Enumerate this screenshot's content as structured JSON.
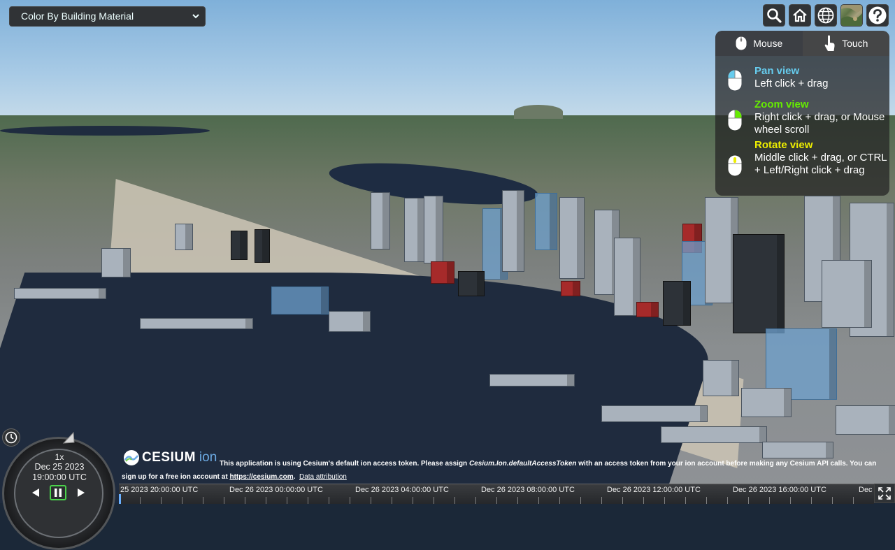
{
  "material_select": {
    "value": "Color By Building Material"
  },
  "toolbar": {
    "geocoder": "search-icon",
    "home": "home-icon",
    "scene_mode": "globe-icon",
    "base_layer": "imagery-thumbnail-icon",
    "help": "question-icon"
  },
  "navigation_help": {
    "tabs": [
      {
        "label": "Mouse",
        "active": true
      },
      {
        "label": "Touch",
        "active": false
      }
    ],
    "instructions": [
      {
        "title": "Pan view",
        "desc": "Left click + drag",
        "color": "#66ccee"
      },
      {
        "title": "Zoom view",
        "desc": "Right click + drag, or Mouse wheel scroll",
        "color": "#65ec00"
      },
      {
        "title": "Rotate view",
        "desc": "Middle click + drag, or CTRL + Left/Right click + drag",
        "color": "#eeee00"
      }
    ]
  },
  "animation": {
    "speed": "1x",
    "date": "Dec 25 2023",
    "time": "19:00:00 UTC"
  },
  "credits": {
    "logo_text": "CESIUM",
    "logo_ion": "ion",
    "line1_a": "This application is using Cesium's default ion access token. Please assign ",
    "line1_code": "Cesium.Ion.defaultAccessToken",
    "line1_b": " with an access token from your ion account before making any Cesium API calls. You can",
    "line2_a": "sign up for a free ion account at ",
    "line2_link": "https://cesium.com",
    "line2_b": ".",
    "attribution": "Data attribution"
  },
  "timeline": {
    "labels": [
      "25 2023 20:00:00 UTC",
      "Dec 26 2023 00:00:00 UTC",
      "Dec 26 2023 04:00:00 UTC",
      "Dec 26 2023 08:00:00 UTC",
      "Dec 26 2023 12:00:00 UTC",
      "Dec 26 2023 16:00:00 UTC",
      "Dec"
    ]
  }
}
